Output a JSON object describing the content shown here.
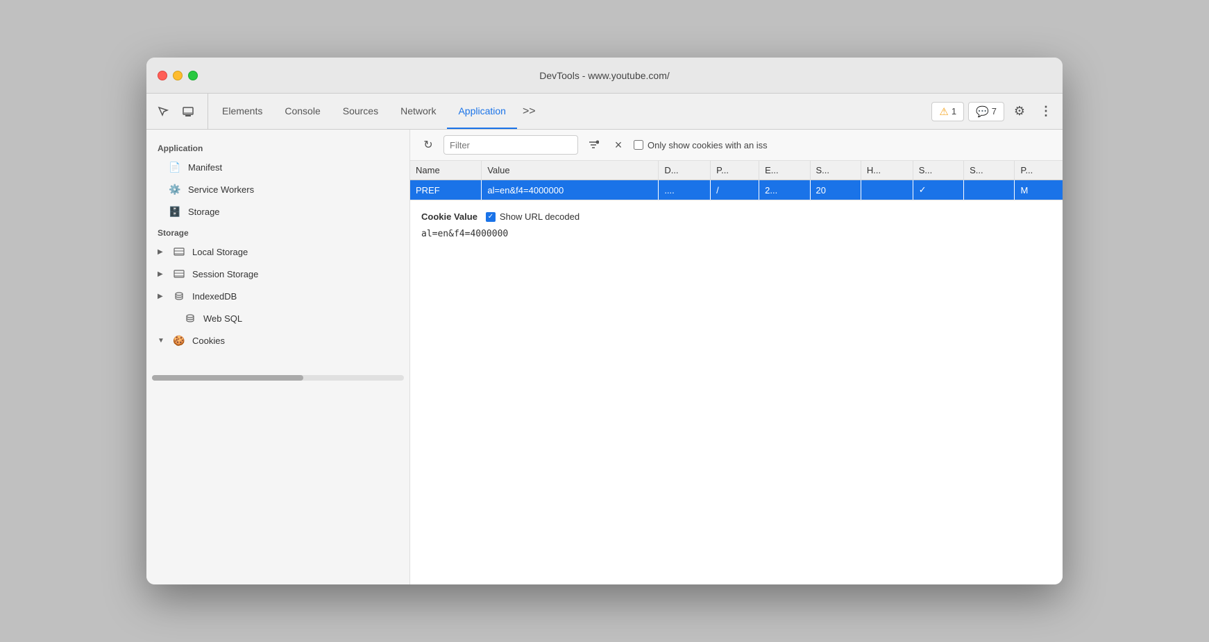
{
  "window": {
    "title": "DevTools - www.youtube.com/"
  },
  "tabs": {
    "items": [
      {
        "label": "Elements",
        "active": false
      },
      {
        "label": "Console",
        "active": false
      },
      {
        "label": "Sources",
        "active": false
      },
      {
        "label": "Network",
        "active": false
      },
      {
        "label": "Application",
        "active": true
      }
    ],
    "overflow_label": ">>",
    "warning_badge": "1",
    "info_badge": "7"
  },
  "sidebar": {
    "application_section": "Application",
    "app_items": [
      {
        "label": "Manifest",
        "icon": "📄"
      },
      {
        "label": "Service Workers",
        "icon": "⚙️"
      },
      {
        "label": "Storage",
        "icon": "🗄️"
      }
    ],
    "storage_section": "Storage",
    "storage_items": [
      {
        "label": "Local Storage",
        "has_arrow": true,
        "collapsed": true
      },
      {
        "label": "Session Storage",
        "has_arrow": true,
        "collapsed": true
      },
      {
        "label": "IndexedDB",
        "has_arrow": true,
        "collapsed": true
      },
      {
        "label": "Web SQL",
        "has_arrow": false
      },
      {
        "label": "Cookies",
        "has_arrow": true,
        "collapsed": false,
        "expanded": true
      }
    ]
  },
  "cookie_panel": {
    "filter_placeholder": "Filter",
    "only_show_label": "Only show cookies with an iss",
    "table": {
      "columns": [
        "Name",
        "Value",
        "D...",
        "P...",
        "E...",
        "S...",
        "H...",
        "S...",
        "S...",
        "P..."
      ],
      "rows": [
        {
          "name": "PREF",
          "value": "al=en&f4=4000000",
          "d": "....",
          "p": "/",
          "e": "2...",
          "s": "20",
          "h": "",
          "s2": "✓",
          "s3": "",
          "p2": "M",
          "selected": true
        }
      ]
    },
    "cookie_value_label": "Cookie Value",
    "show_url_decoded_label": "Show URL decoded",
    "cookie_value_text": "al=en&f4=4000000"
  }
}
